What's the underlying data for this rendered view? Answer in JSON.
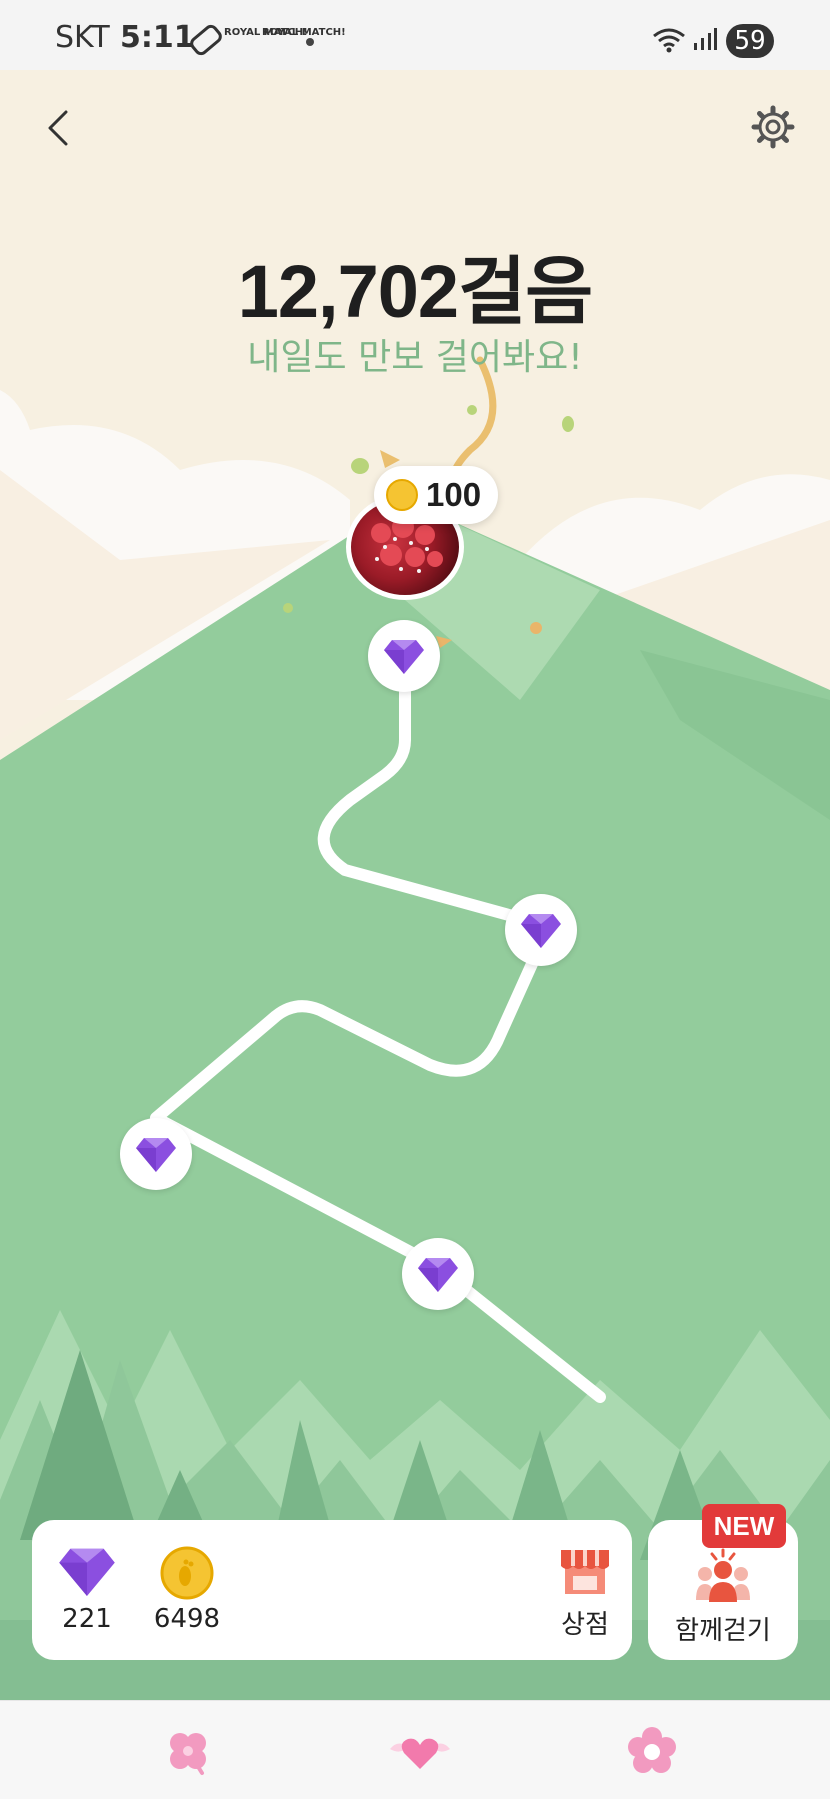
{
  "status_bar": {
    "carrier": "SKT",
    "time": "5:11",
    "app_badges": [
      "ROYAL MATCH!",
      "ROYAL MATCH!"
    ],
    "battery": "59"
  },
  "header": {
    "back_icon": "chevron-left-icon",
    "settings_icon": "gear-icon"
  },
  "hero": {
    "steps": "12,702걸음",
    "message": "내일도 만보 걸어봐요!"
  },
  "reward": {
    "coin_amount": "100"
  },
  "path_nodes": [
    {
      "reward": "gem"
    },
    {
      "reward": "gem"
    },
    {
      "reward": "gem"
    },
    {
      "reward": "gem"
    }
  ],
  "wallet": {
    "gems": "221",
    "coins": "6498",
    "shop_label": "상점"
  },
  "walk_together": {
    "label": "함께걷기",
    "badge": "NEW"
  },
  "tabs": [
    {
      "icon": "clover-icon"
    },
    {
      "icon": "heart-wings-icon"
    },
    {
      "icon": "flower-icon"
    }
  ],
  "colors": {
    "mountain": "#93cc9c",
    "sky": "#f7f0e1",
    "accent_text": "#7fb689",
    "gem": "#8b4fe0",
    "coin": "#f5c432",
    "new_badge": "#e23a3a"
  }
}
